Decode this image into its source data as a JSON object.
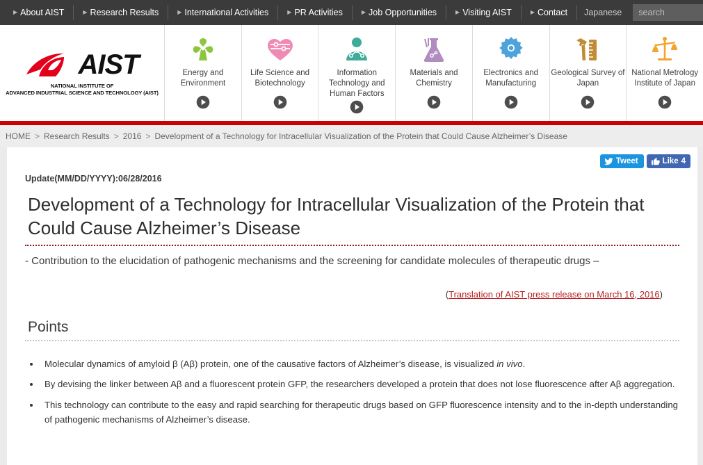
{
  "topnav": {
    "items": [
      {
        "label": "About AIST"
      },
      {
        "label": "Research Results"
      },
      {
        "label": "International Activities"
      },
      {
        "label": "PR Activities"
      },
      {
        "label": "Job Opportunities"
      },
      {
        "label": "Visiting AIST"
      },
      {
        "label": "Contact"
      }
    ],
    "language_label": "Japanese",
    "search_placeholder": "search",
    "search_value": ""
  },
  "logo": {
    "wordmark": "AIST",
    "subtitle_line1": "NATIONAL INSTITUTE OF",
    "subtitle_line2": "ADVANCED INDUSTRIAL SCIENCE AND TECHNOLOGY (AIST)"
  },
  "categories": [
    {
      "label": "Energy and Environment",
      "icon": "windmill-icon",
      "color": "#8cc63e"
    },
    {
      "label": "Life Science and Biotechnology",
      "icon": "heart-icon",
      "color": "#ef8ab5"
    },
    {
      "label": "Information Technology and Human Factors",
      "icon": "person-network-icon",
      "color": "#3fab9b"
    },
    {
      "label": "Materials and Chemistry",
      "icon": "flask-icon",
      "color": "#b08cc0"
    },
    {
      "label": "Electronics and Manufacturing",
      "icon": "gear-icon",
      "color": "#4ea3db"
    },
    {
      "label": "Geological Survey of Japan",
      "icon": "hammer-ruler-icon",
      "color": "#c28c36"
    },
    {
      "label": "National Metrology Institute of Japan",
      "icon": "scales-icon",
      "color": "#f2a52a"
    }
  ],
  "breadcrumb": {
    "items": [
      "HOME",
      "Research Results",
      "2016",
      "Development of a Technology for Intracellular Visualization of the Protein that Could Cause Alzheimer’s Disease"
    ],
    "separator": ">"
  },
  "social": {
    "tweet_label": "Tweet",
    "like_label": "Like",
    "like_count": "4"
  },
  "article": {
    "update_line": "Update(MM/DD/YYYY):06/28/2016",
    "title": "Development of a Technology for Intracellular Visualization of the Protein that Could Cause Alzheimer’s Disease",
    "subtitle": "- Contribution to the elucidation of pathogenic mechanisms and the screening for candidate molecules of therapeutic drugs –",
    "translation_prefix": "(",
    "translation_link": "Translation of AIST press release on March 16, 2016",
    "translation_suffix": ")",
    "points_heading": "Points",
    "points": [
      {
        "pre": "Molecular dynamics of amyloid β (Aβ) protein, one of the causative factors of Alzheimer’s disease, is visualized ",
        "em": "in vivo",
        "post": "."
      },
      {
        "pre": "By devising the linker between Aβ and a fluorescent protein GFP, the researchers developed a protein that does not lose fluorescence after Aβ aggregation.",
        "em": "",
        "post": ""
      },
      {
        "pre": "This technology can contribute to the easy and rapid searching for therapeutic drugs based on GFP fluorescence intensity and to the in-depth understanding of pathogenic mechanisms of Alzheimer’s disease.",
        "em": "",
        "post": ""
      }
    ]
  },
  "colors": {
    "topnav_bg": "#3b3b3b",
    "accent_red": "#cc0000",
    "title_rule": "#8c1a1a",
    "link_red": "#b41f1f",
    "twitter_blue": "#1b95e0",
    "facebook_blue": "#4267b2"
  }
}
